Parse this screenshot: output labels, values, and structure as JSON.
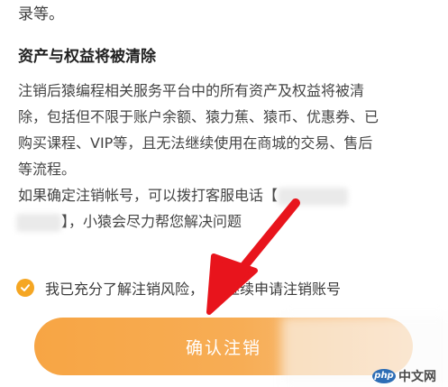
{
  "intro": {
    "text": "录等。"
  },
  "section": {
    "title": "资产与权益将被清除"
  },
  "paragraph1": {
    "lines": [
      "注销后猿编程相关服务平台中的所有资产及权益将被清",
      "除，包括但不限于账户余额、猿力蕉、猿币、优惠券、已",
      "购买课程、VIP等，且无法继续使用在商城的交易、售后",
      "等流程。"
    ]
  },
  "paragraph2": {
    "line1_start": "如果确定注销帐号，可以拨打客服电话【",
    "line2_end": "】，小猿会尽力帮您解决问题"
  },
  "agree": {
    "part1": "我已充分了解注销风险，",
    "part2": "继续申请注销账号"
  },
  "confirm_button": {
    "label": "确认注销"
  },
  "colors": {
    "accent": "#f5a623",
    "arrow": "#e8141c"
  },
  "watermark": {
    "logo": "php",
    "text": "中文网"
  }
}
